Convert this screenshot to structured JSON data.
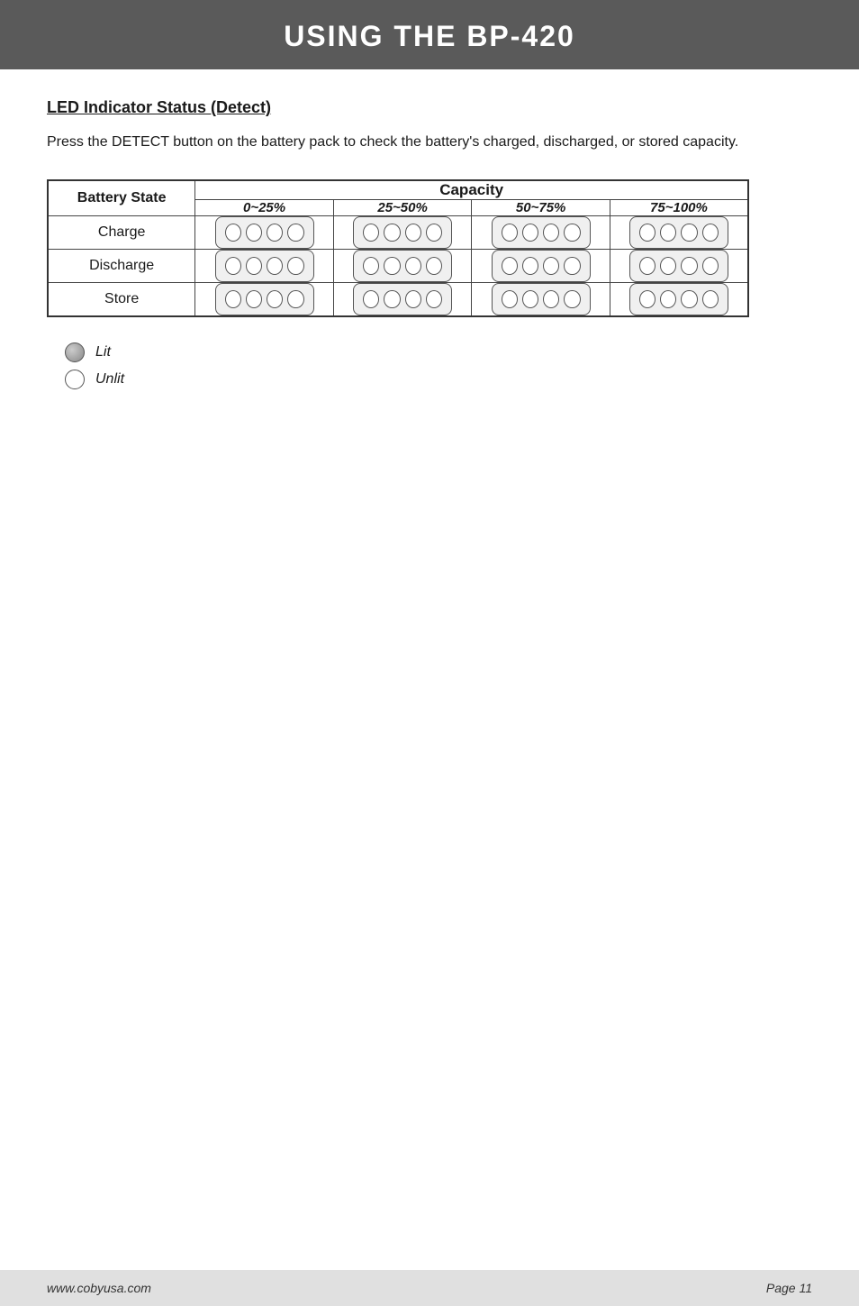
{
  "header": {
    "title": "USING THE BP-420"
  },
  "section": {
    "heading": "LED Indicator Status (Detect)",
    "intro": "Press the DETECT button on the battery pack to check the battery's charged, discharged, or stored capacity."
  },
  "table": {
    "battery_state_label": "Battery State",
    "capacity_label": "Capacity",
    "ranges": [
      "0~25%",
      "25~50%",
      "50~75%",
      "75~100%"
    ],
    "rows": [
      {
        "state": "Charge",
        "leds": [
          [
            false,
            false,
            false,
            false
          ],
          [
            false,
            false,
            false,
            false
          ],
          [
            false,
            false,
            false,
            false
          ],
          [
            false,
            false,
            false,
            false
          ]
        ]
      },
      {
        "state": "Discharge",
        "leds": [
          [
            false,
            false,
            false,
            false
          ],
          [
            false,
            false,
            false,
            false
          ],
          [
            false,
            false,
            false,
            false
          ],
          [
            false,
            false,
            false,
            false
          ]
        ]
      },
      {
        "state": "Store",
        "leds": [
          [
            false,
            false,
            false,
            false
          ],
          [
            false,
            false,
            false,
            false
          ],
          [
            false,
            false,
            false,
            false
          ],
          [
            false,
            false,
            false,
            false
          ]
        ]
      }
    ]
  },
  "legend": [
    {
      "type": "lit",
      "label": "Lit"
    },
    {
      "type": "unlit",
      "label": "Unlit"
    }
  ],
  "footer": {
    "website": "www.cobyusa.com",
    "page": "Page 11"
  }
}
